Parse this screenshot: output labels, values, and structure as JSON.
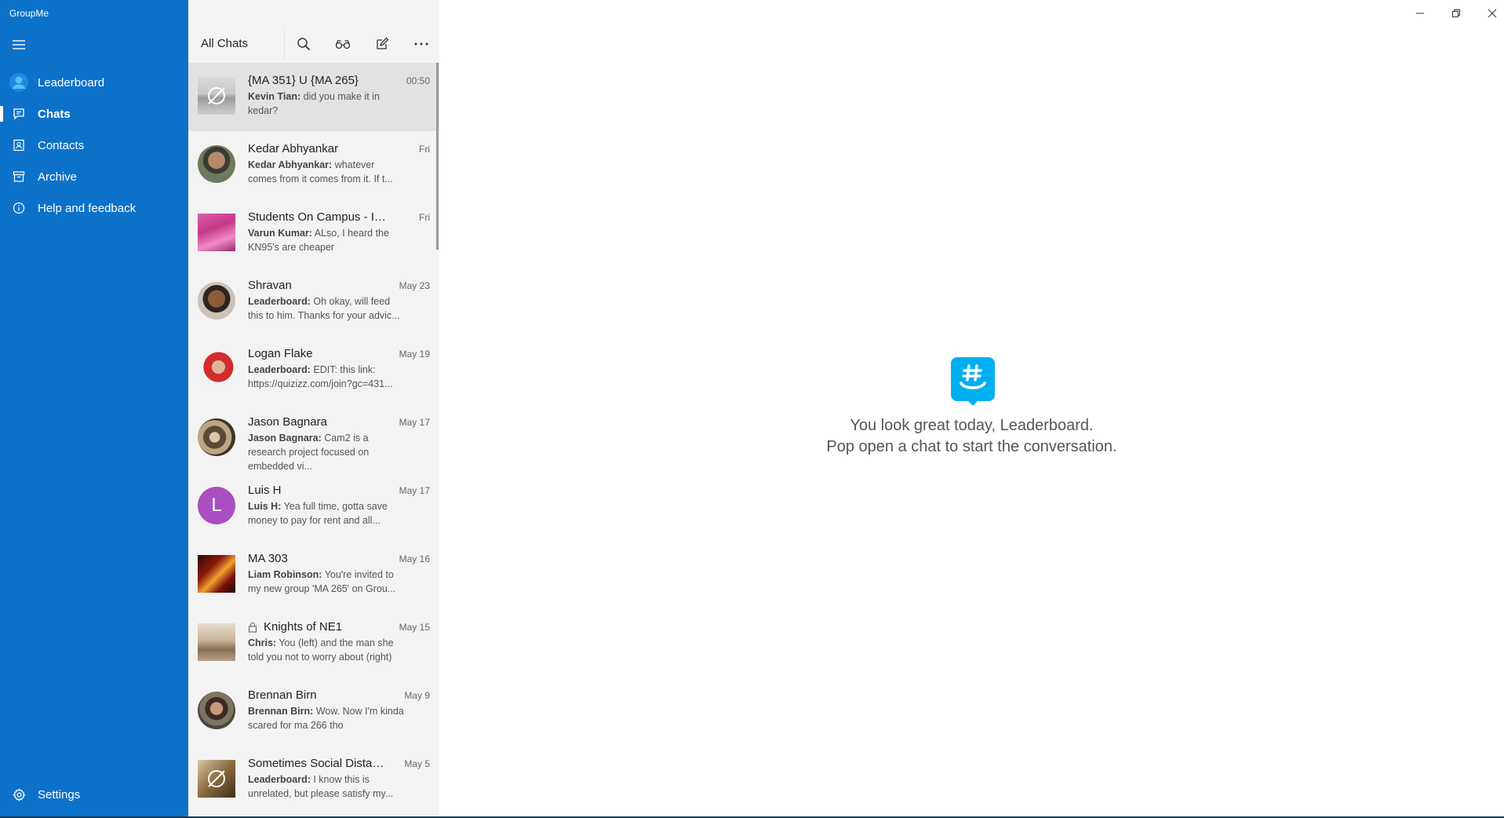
{
  "app": {
    "title": "GroupMe"
  },
  "nav": {
    "items": [
      {
        "label": "Leaderboard",
        "icon": "user-avatar-icon"
      },
      {
        "label": "Chats",
        "icon": "chat-icon",
        "active": true
      },
      {
        "label": "Contacts",
        "icon": "contacts-icon"
      },
      {
        "label": "Archive",
        "icon": "archive-icon"
      },
      {
        "label": "Help and feedback",
        "icon": "info-icon"
      }
    ],
    "settings_label": "Settings"
  },
  "list": {
    "title": "All Chats",
    "chats": [
      {
        "name": "{MA 351} U {MA 265}",
        "time": "00:50",
        "sender": "Kevin Tian:",
        "preview": " did you make it in kedar?"
      },
      {
        "name": "Kedar Abhyankar",
        "time": "Fri",
        "sender": "Kedar Abhyankar:",
        "preview": " whatever comes from it comes from it. If t..."
      },
      {
        "name": "Students On Campus - In...",
        "time": "Fri",
        "sender": "Varun Kumar:",
        "preview": " ALso, I heard the KN95's are cheaper"
      },
      {
        "name": "Shravan",
        "time": "May 23",
        "sender": "Leaderboard:",
        "preview": " Oh okay, will feed this to him. Thanks for your advic..."
      },
      {
        "name": "Logan Flake",
        "time": "May 19",
        "sender": "Leaderboard:",
        "preview": " EDIT: this link: https://quizizz.com/join?gc=431..."
      },
      {
        "name": "Jason Bagnara",
        "time": "May 17",
        "sender": "Jason Bagnara:",
        "preview": " Cam2 is a research project focused on embedded vi..."
      },
      {
        "name": "Luis H",
        "time": "May 17",
        "sender": "Luis H:",
        "preview": " Yea full time, gotta save money to pay for rent and all...",
        "initial": "L"
      },
      {
        "name": "MA 303",
        "time": "May 16",
        "sender": "Liam Robinson:",
        "preview": " You're invited to my new group 'MA 265' on Grou..."
      },
      {
        "name": "Knights of NE1",
        "time": "May 15",
        "sender": "Chris:",
        "preview": " You (left) and the man she told you not to worry about (right)"
      },
      {
        "name": "Brennan Birn",
        "time": "May 9",
        "sender": "Brennan Birn:",
        "preview": " Wow. Now I'm kinda scared for ma 266 tho"
      },
      {
        "name": "Sometimes Social Distanc...",
        "time": "May 5",
        "sender": "Leaderboard:",
        "preview": " I know this is unrelated, but please satisfy my..."
      }
    ]
  },
  "main": {
    "greeting_line1": "You look great today, Leaderboard.",
    "greeting_line2": "Pop open a chat to start the conversation."
  },
  "colors": {
    "accent": "#0c72c9",
    "logo": "#00aff0"
  }
}
